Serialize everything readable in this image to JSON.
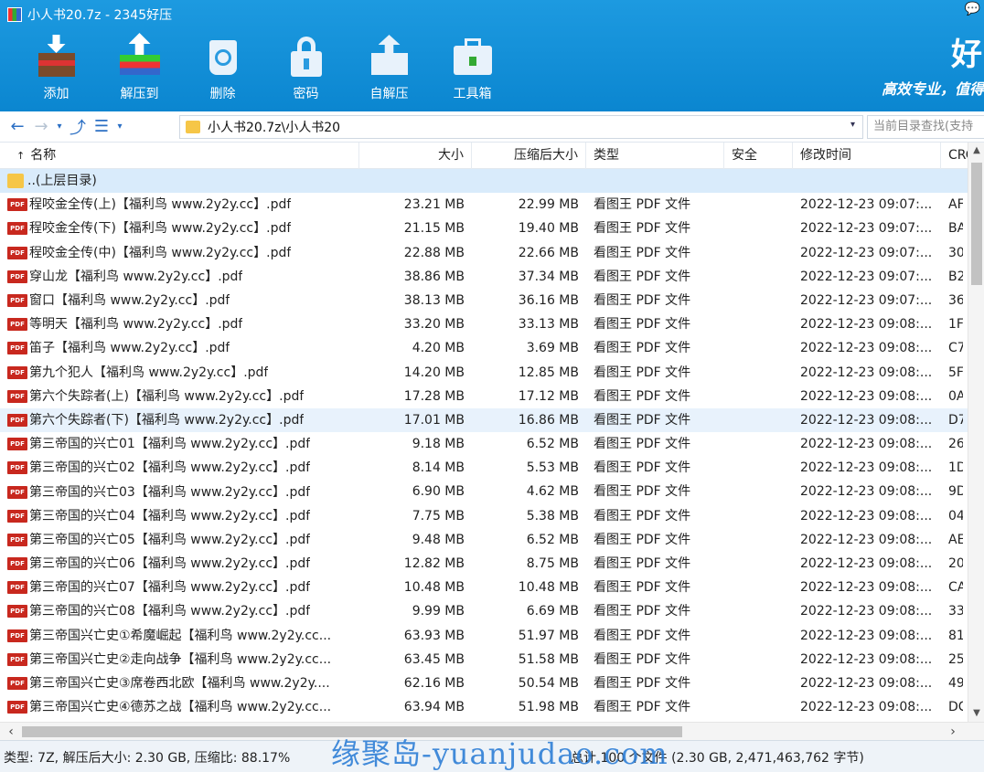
{
  "window": {
    "title": "小人书20.7z - 2345好压",
    "chat_icon": "💬"
  },
  "toolbar": [
    {
      "label": "添加",
      "icon": "add-icon"
    },
    {
      "label": "解压到",
      "icon": "extract-icon"
    },
    {
      "label": "删除",
      "icon": "delete-icon"
    },
    {
      "label": "密码",
      "icon": "password-lock-icon"
    },
    {
      "label": "自解压",
      "icon": "self-extract-icon"
    },
    {
      "label": "工具箱",
      "icon": "toolbox-icon"
    }
  ],
  "brand": {
    "big": "好",
    "slogan": "高效专业，值得"
  },
  "address": {
    "path": "小人书20.7z\\小人书20",
    "search_placeholder": "当前目录查找(支持",
    "nav": {
      "back": "←",
      "forward": "→",
      "history": "▾",
      "up": "⤴",
      "view": "☰",
      "view_drop": "▾",
      "path_drop": "▾"
    }
  },
  "columns": {
    "name": "名称",
    "size": "大小",
    "csize": "压缩后大小",
    "type": "类型",
    "security": "安全",
    "mtime": "修改时间",
    "crc": "CRC",
    "sort_marker": "↑"
  },
  "parent_row": "..(上层目录)",
  "rows": [
    {
      "name": "程咬金全传(上)【福利鸟  www.2y2y.cc】.pdf",
      "size": "23.21 MB",
      "csize": "22.99 MB",
      "type": "看图王 PDF 文件",
      "mtime": "2022-12-23 09:07:...",
      "crc": "AF"
    },
    {
      "name": "程咬金全传(下)【福利鸟  www.2y2y.cc】.pdf",
      "size": "21.15 MB",
      "csize": "19.40 MB",
      "type": "看图王 PDF 文件",
      "mtime": "2022-12-23 09:07:...",
      "crc": "BA"
    },
    {
      "name": "程咬金全传(中)【福利鸟  www.2y2y.cc】.pdf",
      "size": "22.88 MB",
      "csize": "22.66 MB",
      "type": "看图王 PDF 文件",
      "mtime": "2022-12-23 09:07:...",
      "crc": "30"
    },
    {
      "name": "穿山龙【福利鸟  www.2y2y.cc】.pdf",
      "size": "38.86 MB",
      "csize": "37.34 MB",
      "type": "看图王 PDF 文件",
      "mtime": "2022-12-23 09:07:...",
      "crc": "B2"
    },
    {
      "name": "窗口【福利鸟  www.2y2y.cc】.pdf",
      "size": "38.13 MB",
      "csize": "36.16 MB",
      "type": "看图王 PDF 文件",
      "mtime": "2022-12-23 09:07:...",
      "crc": "36"
    },
    {
      "name": "等明天【福利鸟  www.2y2y.cc】.pdf",
      "size": "33.20 MB",
      "csize": "33.13 MB",
      "type": "看图王 PDF 文件",
      "mtime": "2022-12-23 09:08:...",
      "crc": "1F"
    },
    {
      "name": "笛子【福利鸟  www.2y2y.cc】.pdf",
      "size": "4.20 MB",
      "csize": "3.69 MB",
      "type": "看图王 PDF 文件",
      "mtime": "2022-12-23 09:08:...",
      "crc": "C7"
    },
    {
      "name": "第九个犯人【福利鸟  www.2y2y.cc】.pdf",
      "size": "14.20 MB",
      "csize": "12.85 MB",
      "type": "看图王 PDF 文件",
      "mtime": "2022-12-23 09:08:...",
      "crc": "5F"
    },
    {
      "name": "第六个失踪者(上)【福利鸟  www.2y2y.cc】.pdf",
      "size": "17.28 MB",
      "csize": "17.12 MB",
      "type": "看图王 PDF 文件",
      "mtime": "2022-12-23 09:08:...",
      "crc": "0A"
    },
    {
      "name": "第六个失踪者(下)【福利鸟  www.2y2y.cc】.pdf",
      "size": "17.01 MB",
      "csize": "16.86 MB",
      "type": "看图王 PDF 文件",
      "mtime": "2022-12-23 09:08:...",
      "crc": "D7",
      "hover": true
    },
    {
      "name": "第三帝国的兴亡01【福利鸟  www.2y2y.cc】.pdf",
      "size": "9.18 MB",
      "csize": "6.52 MB",
      "type": "看图王 PDF 文件",
      "mtime": "2022-12-23 09:08:...",
      "crc": "26"
    },
    {
      "name": "第三帝国的兴亡02【福利鸟  www.2y2y.cc】.pdf",
      "size": "8.14 MB",
      "csize": "5.53 MB",
      "type": "看图王 PDF 文件",
      "mtime": "2022-12-23 09:08:...",
      "crc": "1D"
    },
    {
      "name": "第三帝国的兴亡03【福利鸟  www.2y2y.cc】.pdf",
      "size": "6.90 MB",
      "csize": "4.62 MB",
      "type": "看图王 PDF 文件",
      "mtime": "2022-12-23 09:08:...",
      "crc": "9D"
    },
    {
      "name": "第三帝国的兴亡04【福利鸟  www.2y2y.cc】.pdf",
      "size": "7.75 MB",
      "csize": "5.38 MB",
      "type": "看图王 PDF 文件",
      "mtime": "2022-12-23 09:08:...",
      "crc": "04"
    },
    {
      "name": "第三帝国的兴亡05【福利鸟  www.2y2y.cc】.pdf",
      "size": "9.48 MB",
      "csize": "6.52 MB",
      "type": "看图王 PDF 文件",
      "mtime": "2022-12-23 09:08:...",
      "crc": "AE"
    },
    {
      "name": "第三帝国的兴亡06【福利鸟  www.2y2y.cc】.pdf",
      "size": "12.82 MB",
      "csize": "8.75 MB",
      "type": "看图王 PDF 文件",
      "mtime": "2022-12-23 09:08:...",
      "crc": "20"
    },
    {
      "name": "第三帝国的兴亡07【福利鸟  www.2y2y.cc】.pdf",
      "size": "10.48 MB",
      "csize": "10.48 MB",
      "type": "看图王 PDF 文件",
      "mtime": "2022-12-23 09:08:...",
      "crc": "CA"
    },
    {
      "name": "第三帝国的兴亡08【福利鸟  www.2y2y.cc】.pdf",
      "size": "9.99 MB",
      "csize": "6.69 MB",
      "type": "看图王 PDF 文件",
      "mtime": "2022-12-23 09:08:...",
      "crc": "33"
    },
    {
      "name": "第三帝国兴亡史①希魔崛起【福利鸟  www.2y2y.cc...",
      "size": "63.93 MB",
      "csize": "51.97 MB",
      "type": "看图王 PDF 文件",
      "mtime": "2022-12-23 09:08:...",
      "crc": "81"
    },
    {
      "name": "第三帝国兴亡史②走向战争【福利鸟  www.2y2y.cc...",
      "size": "63.45 MB",
      "csize": "51.58 MB",
      "type": "看图王 PDF 文件",
      "mtime": "2022-12-23 09:08:...",
      "crc": "25"
    },
    {
      "name": "第三帝国兴亡史③席卷西北欧【福利鸟  www.2y2y....",
      "size": "62.16 MB",
      "csize": "50.54 MB",
      "type": "看图王 PDF 文件",
      "mtime": "2022-12-23 09:08:...",
      "crc": "49"
    },
    {
      "name": "第三帝国兴亡史④德苏之战【福利鸟  www.2y2y.cc...",
      "size": "63.94 MB",
      "csize": "51.98 MB",
      "type": "看图王 PDF 文件",
      "mtime": "2022-12-23 09:08:...",
      "crc": "DC"
    }
  ],
  "pdf_badge": "PDF",
  "status": {
    "left": "类型: 7Z, 解压后大小: 2.30 GB, 压缩比: 88.17%",
    "right": "总计 100 个文件 (2.30 GB, 2,471,463,762 字节)"
  },
  "watermark": "缘聚岛-yuanjudao.com",
  "colors": {
    "accent": "#0b86d0",
    "selected_row": "#d9ebfb",
    "pdf_badge": "#c8281e"
  }
}
